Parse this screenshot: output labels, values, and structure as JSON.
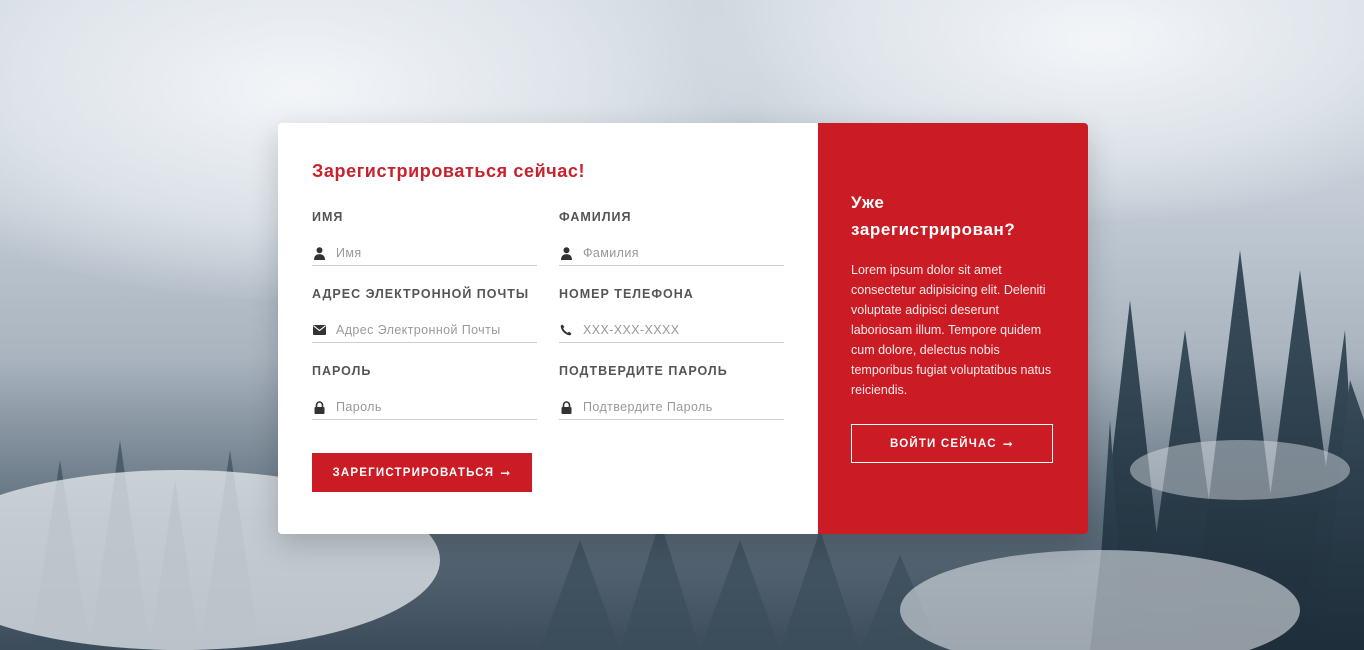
{
  "register": {
    "title": "Зарегистрироваться сейчас!",
    "fields": {
      "first_name": {
        "label": "Имя",
        "placeholder": "Имя",
        "icon": "user-icon"
      },
      "last_name": {
        "label": "Фамилия",
        "placeholder": "Фамилия",
        "icon": "user-icon"
      },
      "email": {
        "label": "Адрес электронной почты",
        "placeholder": "Адрес Электронной Почты",
        "icon": "envelope-icon"
      },
      "phone": {
        "label": "Номер телефона",
        "placeholder": "XXX-XXX-XXXX",
        "icon": "phone-icon"
      },
      "password": {
        "label": "Пароль",
        "placeholder": "Пароль",
        "icon": "lock-icon"
      },
      "confirm_password": {
        "label": "Подтвердите пароль",
        "placeholder": "Подтвердите Пароль",
        "icon": "lock-icon"
      }
    },
    "submit_label": "ЗАРЕГИСТРИРОВАТЬСЯ",
    "submit_arrow": "➞"
  },
  "login": {
    "title": "Уже зарегистрирован?",
    "text": "Lorem ipsum dolor sit amet consectetur adipisicing elit. Deleniti voluptate adipisci deserunt laboriosam illum. Tempore quidem cum dolore, delectus nobis temporibus fugiat voluptatibus natus reiciendis.",
    "button_label": "ВОЙТИ СЕЙЧАС",
    "button_arrow": "➞"
  },
  "colors": {
    "accent": "#cb1b24",
    "title": "#c8222d",
    "label": "#555555"
  }
}
